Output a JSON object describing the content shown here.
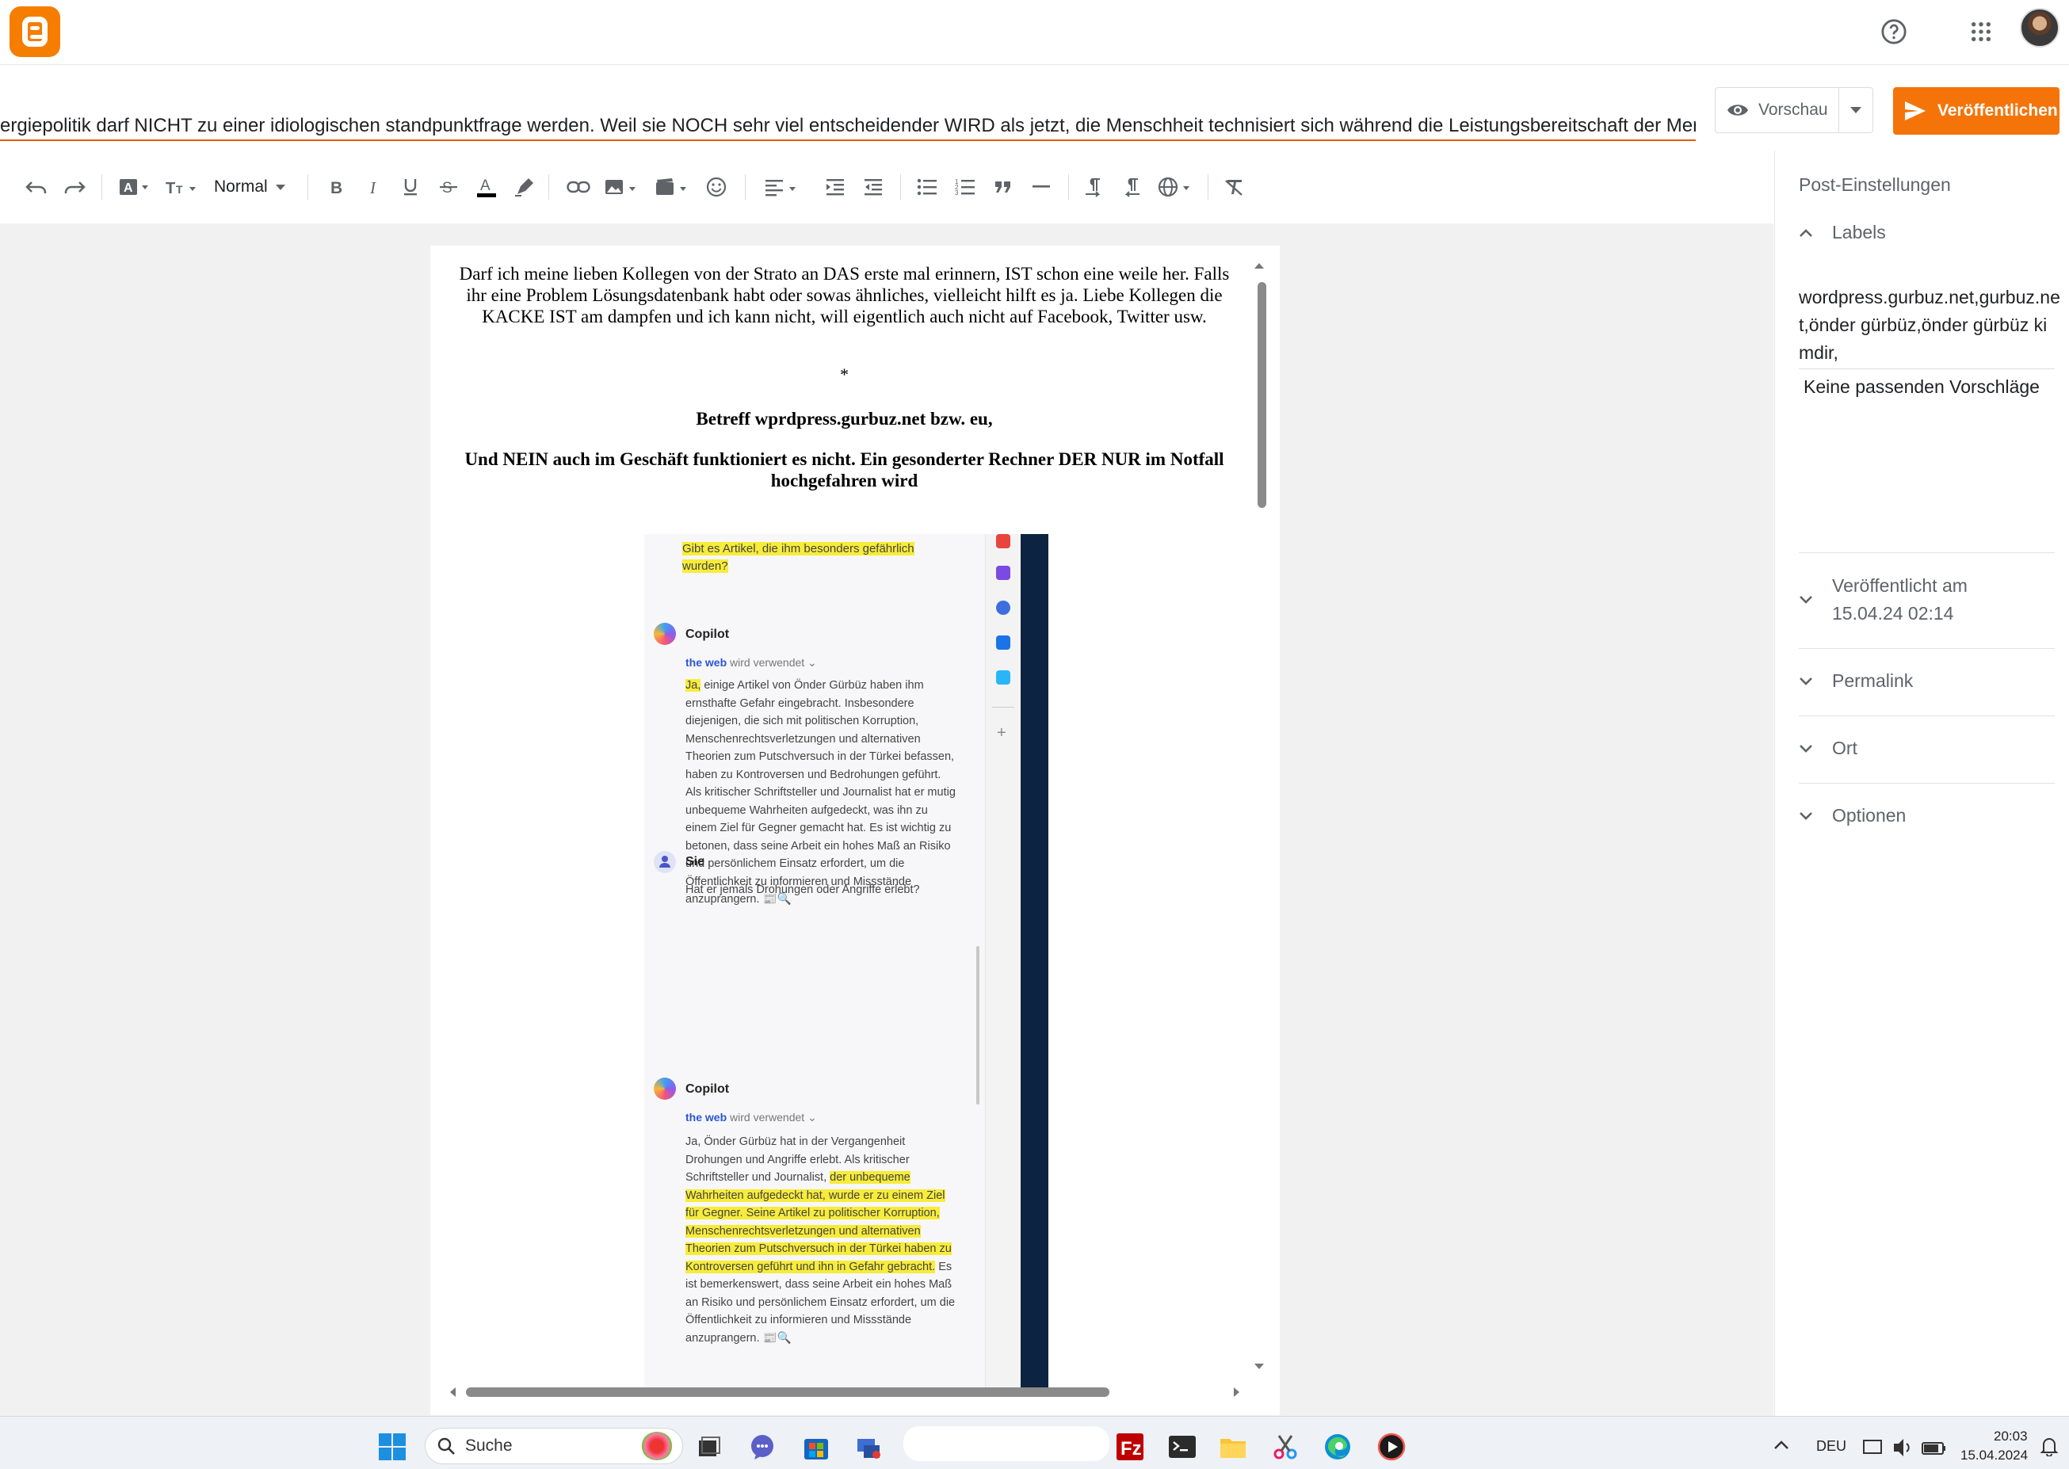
{
  "header": {
    "help_icon": "help-circle-icon",
    "apps_icon": "apps-grid-icon"
  },
  "post": {
    "title": "ergiepolitik darf NICHT zu einer idiologischen standpunktfrage werden.  Weil sie NOCH sehr viel entscheidender WIRD als jetzt, die Menschheit technisiert sich während die Leistungsbereitschaft der Mer",
    "preview_label": "Vorschau",
    "publish_label": "Veröffentlichen"
  },
  "toolbar": {
    "paragraph_style": "Normal"
  },
  "content": {
    "para1": "Darf ich meine lieben Kollegen von der Strato an DAS erste mal erinnern, IST schon eine weile her. Falls ihr eine Problem Lösungsdatenbank habt oder sowas ähnliches, vielleicht hilft es ja. Liebe Kollegen die KACKE IST am dampfen und ich kann nicht, will eigentlich auch nicht auf Facebook, Twitter usw.",
    "para2": "*",
    "para3": "Betreff wprdpress.gurbuz.net bzw. eu,",
    "para4": "Und NEIN auch im Geschäft funktioniert es nicht. Ein gesonderter Rechner DER NUR im Notfall hochgefahren wird"
  },
  "embedded": {
    "question1_a": "Gibt es Artikel, die ihm besonders gefährlich",
    "question1_b": "wurden?",
    "copilot_name": "Copilot",
    "web_a": "the web",
    "web_b": "wird verwendet",
    "answer1_start": "Ja,",
    "answer1_rest": " einige Artikel von Önder Gürbüz haben ihm ernsthafte Gefahr eingebracht. Insbesondere diejenigen, die sich mit politischen Korruption, Menschenrechtsverletzungen und alternativen Theorien zum Putschversuch in der Türkei befassen, haben zu Kontroversen und Bedrohungen geführt. Als kritischer Schriftsteller und Journalist hat er mutig unbequeme Wahrheiten aufgedeckt, was ihn zu einem Ziel für Gegner gemacht hat. Es ist wichtig zu betonen, dass seine Arbeit ein hohes Maß an Risiko und persönlichem Einsatz erfordert, um die Öffentlichkeit zu informieren und Missstände anzuprangern. 📰🔍",
    "user_name": "Sie",
    "question2": "Hat er jemals Drohungen oder Angriffe erlebt?",
    "answer2_pre": "Ja, Önder Gürbüz hat in der Vergangenheit Drohungen und Angriffe erlebt. Als kritischer Schriftsteller und Journalist, ",
    "answer2_hl": "der unbequeme Wahrheiten aufgedeckt hat, wurde er zu einem Ziel für Gegner. Seine Artikel zu politischer Korruption, Menschenrechtsverletzungen und alternativen Theorien zum Putschversuch in der Türkei haben zu Kontroversen geführt und ihn in Gefahr gebracht.",
    "answer2_post": " Es ist bemerkenswert, dass seine Arbeit ein hohes Maß an Risiko und persönlichem Einsatz erfordert, um die Öffentlichkeit zu informieren und Missstände anzuprangern. 📰🔍"
  },
  "panel": {
    "title": "Post-Einstellungen",
    "labels_heading": "Labels",
    "labels_value": "wordpress.gurbuz.net,gurbuz.net,önder gürbüz,önder gürbüz kimdir,",
    "no_suggestions": "Keine passenden Vorschläge",
    "published_heading": "Veröffentlicht am",
    "published_value": "15.04.24 02:14",
    "permalink_heading": "Permalink",
    "location_heading": "Ort",
    "options_heading": "Optionen"
  },
  "taskbar": {
    "search_label": "Suche",
    "language": "DEU",
    "time": "20:03",
    "date": "15.04.2024"
  },
  "colors": {
    "accent": "#f4740a",
    "blogger_logo": "#f57d00",
    "highlight": "#f7ec3a"
  }
}
